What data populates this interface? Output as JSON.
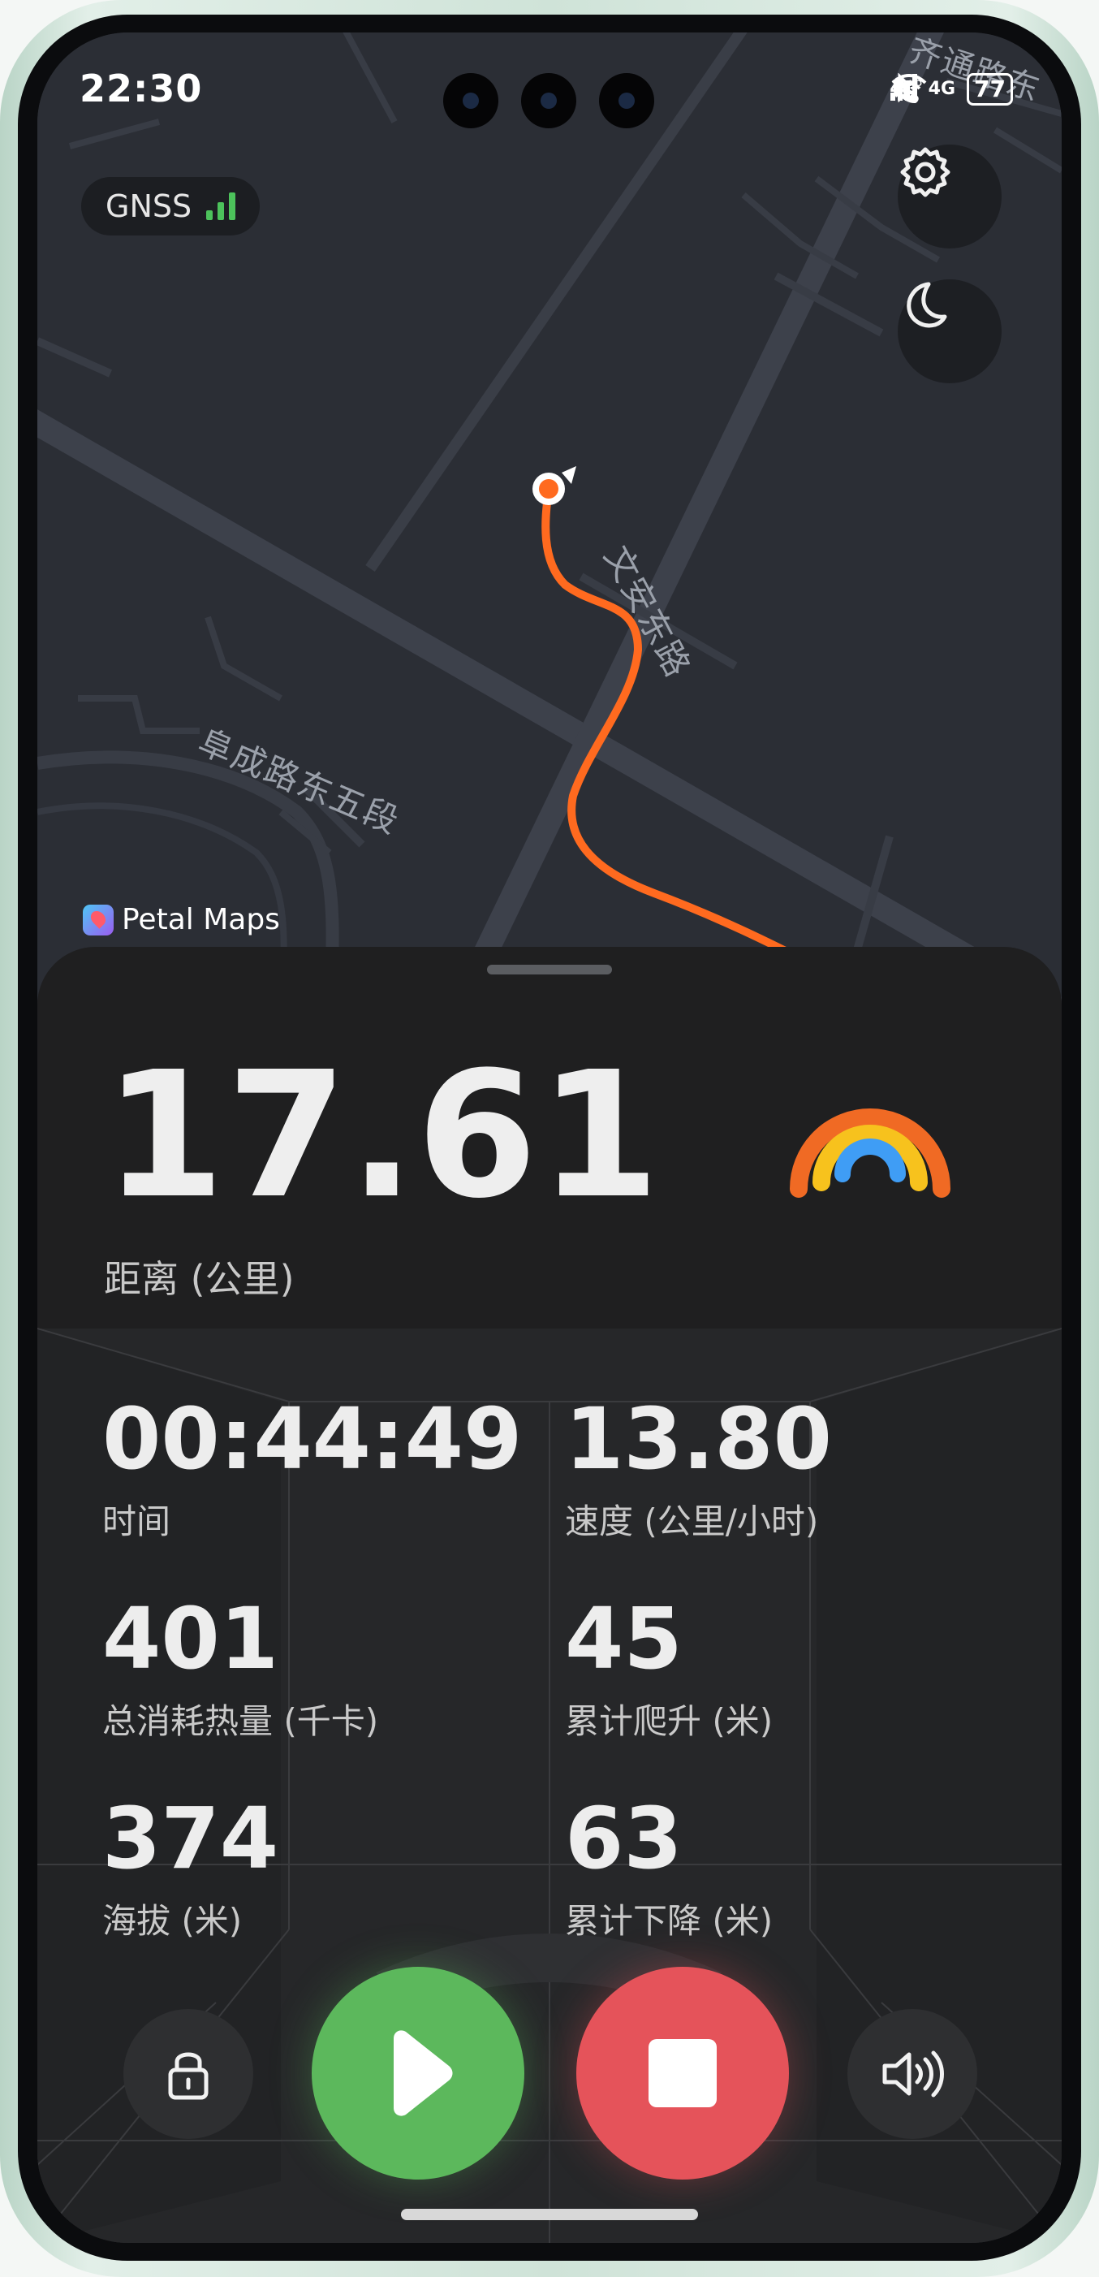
{
  "status_bar": {
    "time": "22:30",
    "signal_1": "4G",
    "signal_2": "4G",
    "battery": "77",
    "icons": [
      "bluetooth-icon",
      "hd-call-icon",
      "wifi-icon",
      "cell-signal-icon",
      "cell-signal-icon",
      "battery-icon",
      "leaf-icon"
    ]
  },
  "map": {
    "gnss_label": "GNSS",
    "gnss_strength": 3,
    "provider": "Petal Maps",
    "road_labels": [
      "齐通路东",
      "文安东路",
      "阜成路东五段"
    ],
    "route_color": "#ff6a1f",
    "icons": [
      "settings-icon",
      "moon-icon"
    ]
  },
  "summary": {
    "distance_value": "17.61",
    "distance_label": "距离 (公里)"
  },
  "stats": [
    {
      "value": "00:44:49",
      "label": "时间"
    },
    {
      "value": "13.80",
      "label": "速度 (公里/小时)"
    },
    {
      "value": "401",
      "label": "总消耗热量 (千卡)"
    },
    {
      "value": "45",
      "label": "累计爬升 (米)"
    },
    {
      "value": "374",
      "label": "海拔 (米)"
    },
    {
      "value": "63",
      "label": "累计下降 (米)"
    }
  ],
  "controls": {
    "icons": [
      "lock-icon",
      "play-icon",
      "stop-icon",
      "volume-icon"
    ],
    "play_color": "#5cb85c",
    "stop_color": "#e5535a"
  }
}
